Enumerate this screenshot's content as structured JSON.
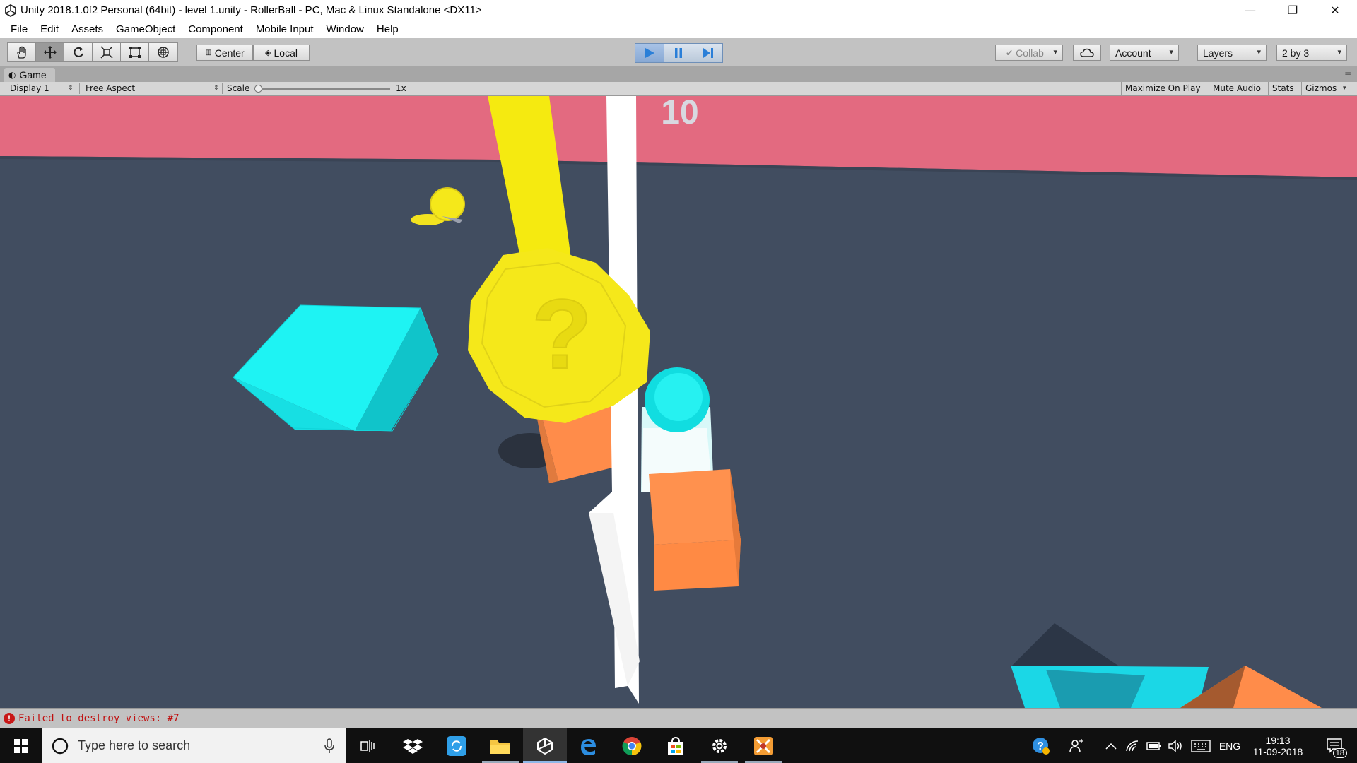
{
  "window": {
    "title": "Unity 2018.1.0f2 Personal (64bit) - level 1.unity - RollerBall - PC, Mac & Linux Standalone <DX11>",
    "minimize": "—",
    "restore": "❐",
    "close": "✕"
  },
  "menu": [
    "File",
    "Edit",
    "Assets",
    "GameObject",
    "Component",
    "Mobile Input",
    "Window",
    "Help"
  ],
  "toolbar": {
    "tools": [
      "hand-tool",
      "move-tool",
      "rotate-tool",
      "scale-tool",
      "rect-tool",
      "transform-tool"
    ],
    "active_tool": 1,
    "pivot_center": "Center",
    "pivot_local": "Local",
    "play_state": "playing",
    "collab": "Collab",
    "account": "Account",
    "layers": "Layers",
    "layout": "2 by 3"
  },
  "game_tab": {
    "label": "Game"
  },
  "game_bar": {
    "display": "Display 1",
    "aspect": "Free Aspect",
    "scale_label": "Scale",
    "scale_value": "1x",
    "maximize_on_play": "Maximize On Play",
    "mute_audio": "Mute Audio",
    "stats": "Stats",
    "gizmos": "Gizmos"
  },
  "hud": {
    "score": "10"
  },
  "status": {
    "message": "Failed to destroy views: #7"
  },
  "taskbar": {
    "search_placeholder": "Type here to search",
    "apps": [
      "task-view-icon",
      "dropbox-icon",
      "sync-app-icon",
      "file-explorer-icon",
      "unity-icon",
      "edge-icon",
      "chrome-icon",
      "store-icon",
      "settings-icon",
      "game-app-icon"
    ],
    "active_app": "unity-icon",
    "language": "ENG",
    "time": "19:13",
    "date": "11-09-2018",
    "notifications": "18"
  },
  "colors": {
    "sky": "#e36a80",
    "ground": "#414d60",
    "coin": "#f5e81a",
    "cyan": "#18eef0",
    "orange": "#ff8c4a",
    "play_active": "#2a7fd8"
  }
}
